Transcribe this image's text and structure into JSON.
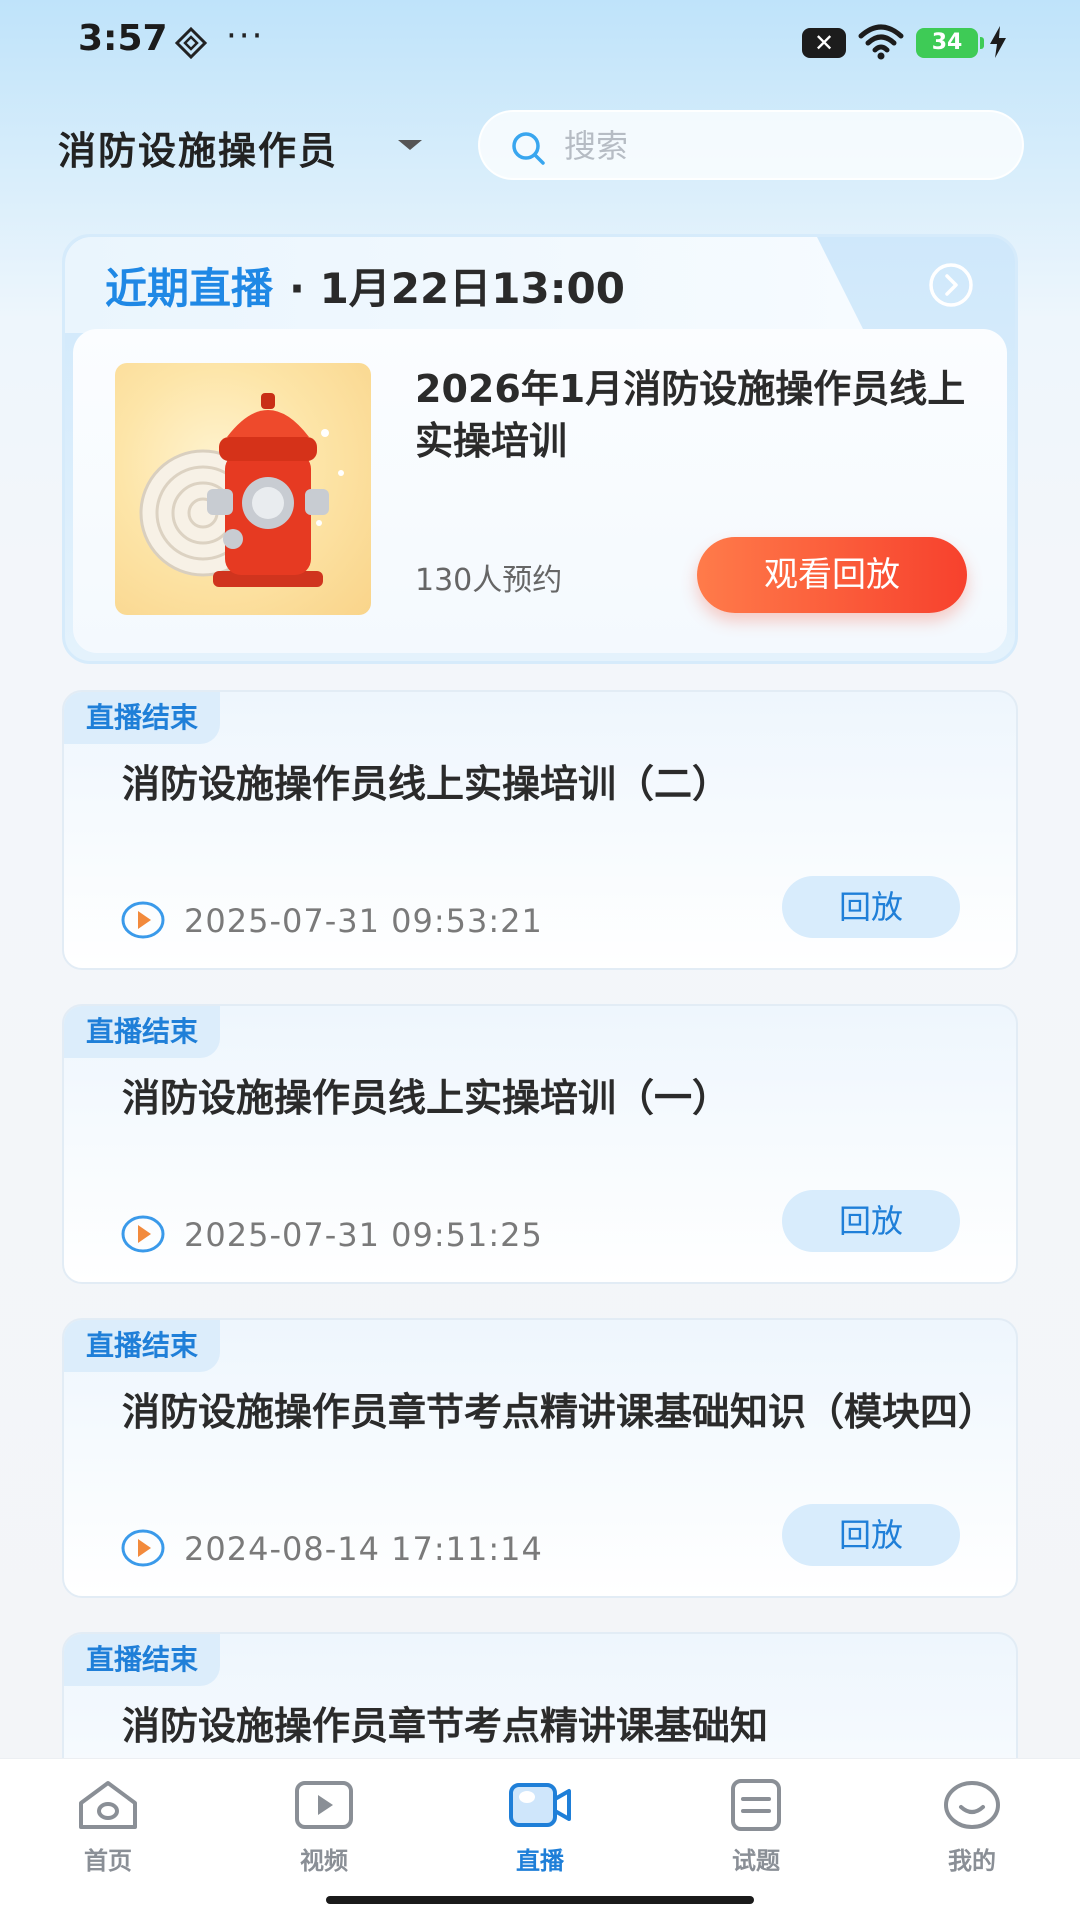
{
  "status_bar": {
    "time": "3:57",
    "dots": "···",
    "x_badge": "✕",
    "battery": "34"
  },
  "header": {
    "category": "消防设施操作员",
    "search_placeholder": "搜索"
  },
  "upcoming_live": {
    "heading": "近期直播",
    "time": "· 1月22日13:00",
    "title": "2026年1月消防设施操作员线上实操培训",
    "reservations": "130人预约",
    "watch_label": "观看回放"
  },
  "sessions": [
    {
      "badge": "直播结束",
      "title": "消防设施操作员线上实操培训（二）",
      "date": "2025-07-31 09:53:21",
      "action": "回放"
    },
    {
      "badge": "直播结束",
      "title": "消防设施操作员线上实操培训（一）",
      "date": "2025-07-31 09:51:25",
      "action": "回放"
    },
    {
      "badge": "直播结束",
      "title": "消防设施操作员章节考点精讲课基础知识（模块四）",
      "date": "2024-08-14 17:11:14",
      "action": "回放"
    },
    {
      "badge": "直播结束",
      "title": "消防设施操作员章节考点精讲课基础知"
    }
  ],
  "bottom_nav": [
    {
      "label": "首页",
      "icon": "home-icon"
    },
    {
      "label": "视频",
      "icon": "video-icon"
    },
    {
      "label": "直播",
      "icon": "live-camera-icon",
      "active": true
    },
    {
      "label": "试题",
      "icon": "quiz-icon"
    },
    {
      "label": "我的",
      "icon": "profile-icon"
    }
  ],
  "colors": {
    "accent": "#1f7fd8",
    "watch_gradient_start": "#ff7b4a",
    "watch_gradient_end": "#f7412d",
    "play_icon": "#f28a3c"
  }
}
